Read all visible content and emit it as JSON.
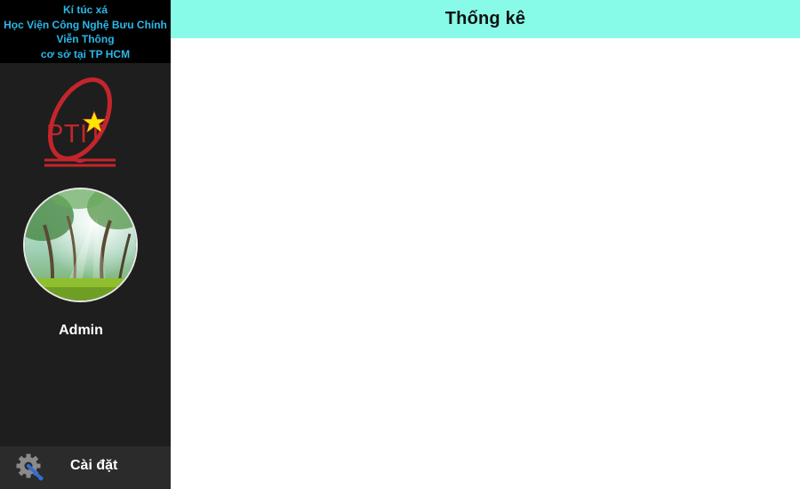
{
  "sidebar": {
    "brand_lines": [
      "Kí túc xá",
      "Học Viện Công Nghệ Bưu Chính",
      "Viễn Thông",
      "cơ sở tại TP HCM"
    ],
    "logo": {
      "icon": "ptit-logo",
      "text": "PTIT"
    },
    "avatar": {
      "icon": "forest-photo"
    },
    "username": "Admin",
    "settings": {
      "label": "Cài đặt",
      "icon": "settings-gear-wrench-icon"
    }
  },
  "header": {
    "title": "Thống kê"
  },
  "colors": {
    "sidebar_bg": "#1e1e1e",
    "brand_bg": "#000000",
    "brand_text": "#2bb8e8",
    "header_bg": "#87fbe8",
    "logo_red": "#c4252c",
    "logo_star": "#ffe600"
  }
}
